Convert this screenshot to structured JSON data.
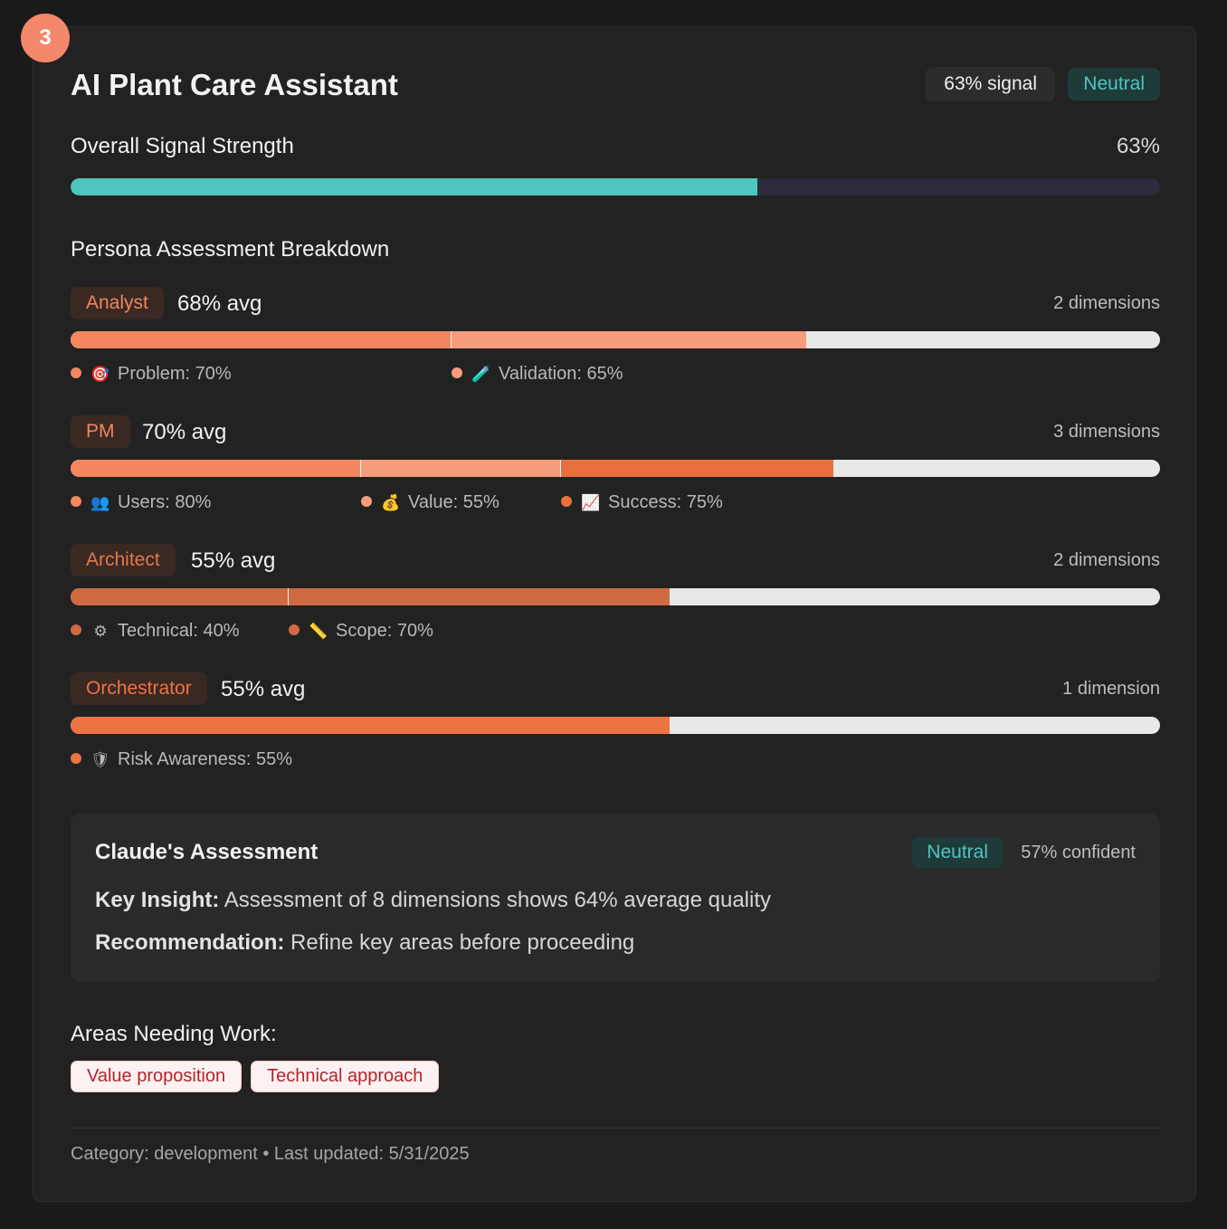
{
  "rank": "3",
  "title": "AI Plant Care Assistant",
  "signal_pill": "63% signal",
  "sentiment_pill": "Neutral",
  "overall": {
    "label": "Overall Signal Strength",
    "value_text": "63%",
    "percent": 63,
    "color": "#4ec5be"
  },
  "breakdown_title": "Persona Assessment Breakdown",
  "personas": [
    {
      "name": "Analyst",
      "avg_text": "68% avg",
      "dims_text": "2 dimensions",
      "tag_color": "#f0865f",
      "dimensions": [
        {
          "label": "Problem: 70%",
          "percent": 70,
          "icon": "target-icon",
          "glyph": "🎯",
          "color": "#f4875f"
        },
        {
          "label": "Validation: 65%",
          "percent": 65,
          "icon": "test-tube-icon",
          "glyph": "🧪",
          "color": "#f79d7c"
        }
      ]
    },
    {
      "name": "PM",
      "avg_text": "70% avg",
      "dims_text": "3 dimensions",
      "tag_color": "#f0865f",
      "dimensions": [
        {
          "label": "Users: 80%",
          "percent": 80,
          "icon": "users-icon",
          "glyph": "👥",
          "color": "#f4875f"
        },
        {
          "label": "Value: 55%",
          "percent": 55,
          "icon": "money-bag-icon",
          "glyph": "💰",
          "color": "#f79d7c"
        },
        {
          "label": "Success: 75%",
          "percent": 75,
          "icon": "chart-up-icon",
          "glyph": "📈",
          "color": "#e8703e"
        }
      ]
    },
    {
      "name": "Architect",
      "avg_text": "55% avg",
      "dims_text": "2 dimensions",
      "tag_color": "#e0794b",
      "dimensions": [
        {
          "label": "Technical: 40%",
          "percent": 40,
          "icon": "gear-icon",
          "glyph": "⚙",
          "color": "#cf6a41"
        },
        {
          "label": "Scope: 70%",
          "percent": 70,
          "icon": "ruler-icon",
          "glyph": "📏",
          "color": "#cf6a41"
        }
      ]
    },
    {
      "name": "Orchestrator",
      "avg_text": "55% avg",
      "dims_text": "1 dimension",
      "tag_color": "#ec7443",
      "dimensions": [
        {
          "label": "Risk Awareness: 55%",
          "percent": 55,
          "icon": "shield-icon",
          "glyph": "🛡",
          "color": "#eb7440"
        }
      ]
    }
  ],
  "assessment": {
    "title": "Claude's Assessment",
    "sentiment": "Neutral",
    "confidence": "57% confident",
    "insight_label": "Key Insight:",
    "insight_text": " Assessment of 8 dimensions shows 64% average quality",
    "rec_label": "Recommendation:",
    "rec_text": " Refine key areas before proceeding"
  },
  "areas_title": "Areas Needing Work:",
  "areas": [
    "Value proposition",
    "Technical approach"
  ],
  "footer": "Category: development • Last updated: 5/31/2025"
}
